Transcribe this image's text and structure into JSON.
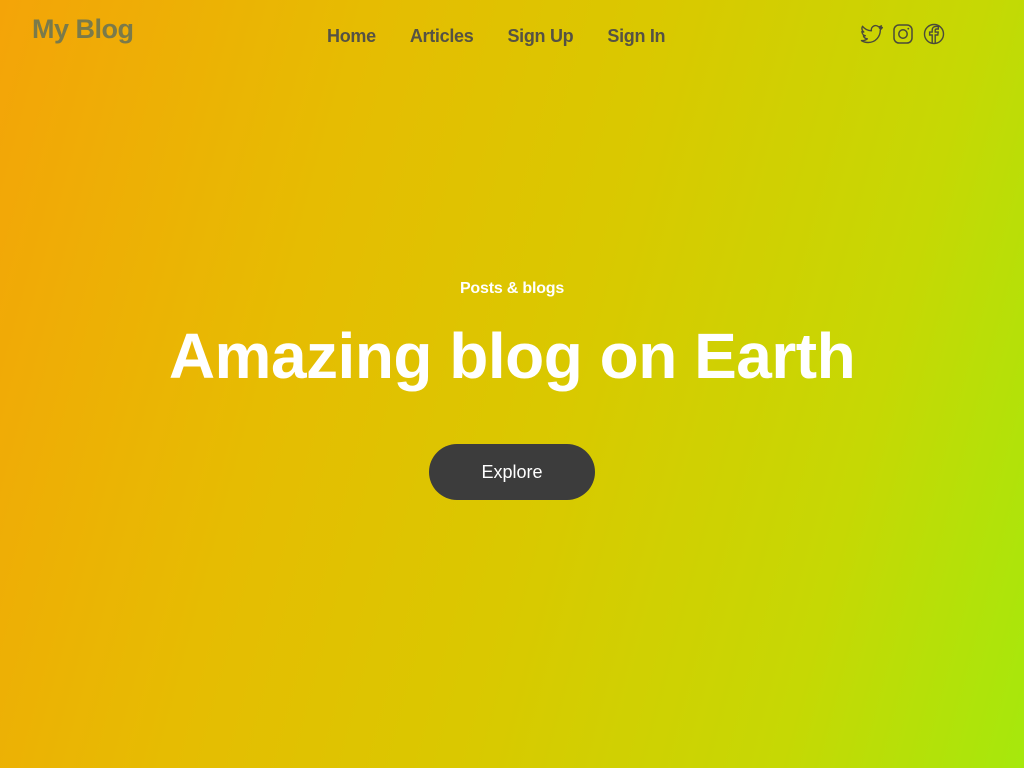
{
  "header": {
    "logo": "My Blog",
    "nav": [
      {
        "label": "Home"
      },
      {
        "label": "Articles"
      },
      {
        "label": "Sign Up"
      },
      {
        "label": "Sign In"
      }
    ],
    "social_icons": [
      "twitter-icon",
      "instagram-icon",
      "facebook-icon"
    ]
  },
  "hero": {
    "eyebrow": "Posts & blogs",
    "title": "Amazing blog on Earth",
    "cta_label": "Explore"
  },
  "colors": {
    "gradient_start": "#f4a408",
    "gradient_end": "#a6e80c",
    "button_bg": "#3c3c3c",
    "hero_text": "#ffffff",
    "nav_text": "#555244"
  }
}
